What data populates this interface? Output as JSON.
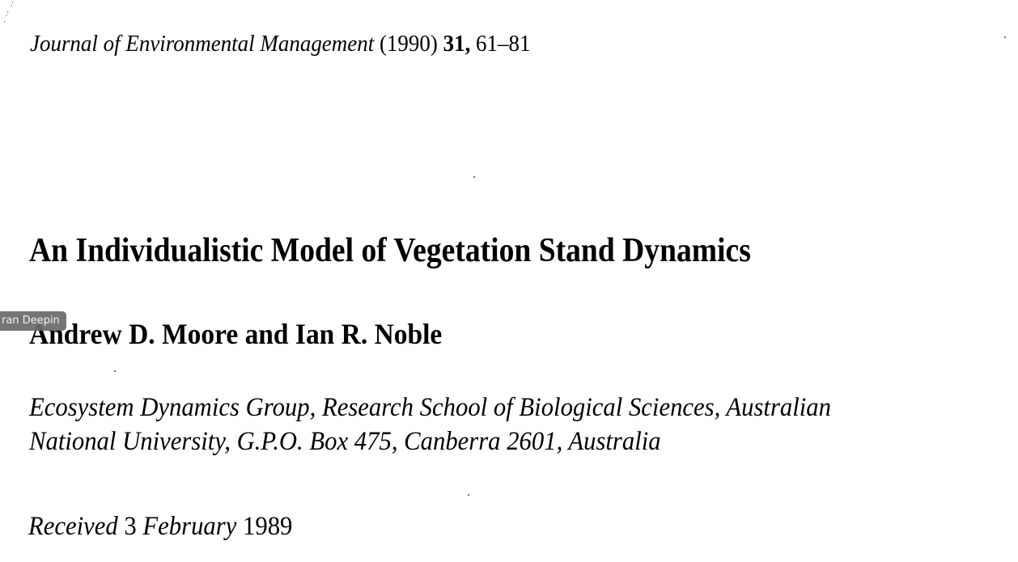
{
  "header": {
    "journal_name": "Journal of Environmental Management",
    "year": "(1990)",
    "volume": "31,",
    "pages": "61–81"
  },
  "title": "An Individualistic Model of Vegetation Stand Dynamics",
  "authors": "Andrew D. Moore and Ian R. Noble",
  "affiliation": {
    "line1": "Ecosystem Dynamics Group, Research School of Biological Sciences, Australian",
    "line2": "National University, G.P.O. Box 475, Canberra 2601, Australia"
  },
  "received": {
    "label": "Received",
    "day": "3",
    "month": "February",
    "year": "1989"
  },
  "overlay": {
    "tooltip_text": "ran Deepin"
  }
}
